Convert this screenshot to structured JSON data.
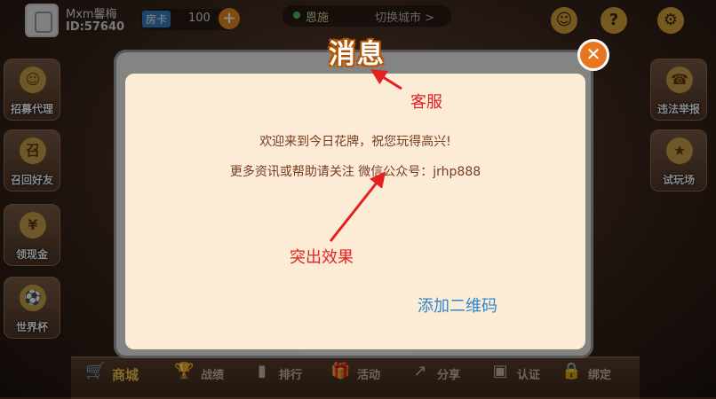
{
  "user": {
    "name": "Mxm馨梅",
    "id": "ID:57640"
  },
  "room_card": {
    "label": "房卡",
    "count": "100",
    "add": "+"
  },
  "city": {
    "name": "恩施",
    "switch_label": "切换城市 >"
  },
  "top_icons": [
    "support-icon",
    "help-icon",
    "settings-icon"
  ],
  "left_menu": [
    {
      "label": "招募代理",
      "glyph": "☺"
    },
    {
      "label": "召回好友",
      "glyph": "召"
    },
    {
      "label": "领现金",
      "glyph": "¥"
    },
    {
      "label": "世界杯",
      "glyph": "⚽"
    }
  ],
  "right_menu": [
    {
      "label": "违法举报",
      "glyph": "☎"
    },
    {
      "label": "试玩场",
      "glyph": "★"
    }
  ],
  "bottom_menu": [
    {
      "label": "商城",
      "icon": "cart-icon",
      "glyph": "🛒"
    },
    {
      "label": "战绩",
      "icon": "trophy-icon",
      "glyph": "🏆"
    },
    {
      "label": "排行",
      "icon": "rank-icon",
      "glyph": "▮"
    },
    {
      "label": "活动",
      "icon": "gift-icon",
      "glyph": "🎁"
    },
    {
      "label": "分享",
      "icon": "share-icon",
      "glyph": "↗"
    },
    {
      "label": "认证",
      "icon": "id-card-icon",
      "glyph": "▣"
    },
    {
      "label": "绑定",
      "icon": "lock-icon",
      "glyph": "🔒"
    }
  ],
  "dialog": {
    "title": "消息",
    "close": "✕",
    "line1": "欢迎来到今日花牌，祝您玩得高兴!",
    "line2": "更多资讯或帮助请关注  微信公众号：jrhp888"
  },
  "annotations": {
    "service": "客服",
    "highlight": "突出效果",
    "qr": "添加二维码"
  },
  "colors": {
    "annotation_red": "#e42020",
    "annotation_link": "#2e86d0",
    "dialog_bg": "#fcecd6",
    "close_orange": "#e8761e"
  }
}
